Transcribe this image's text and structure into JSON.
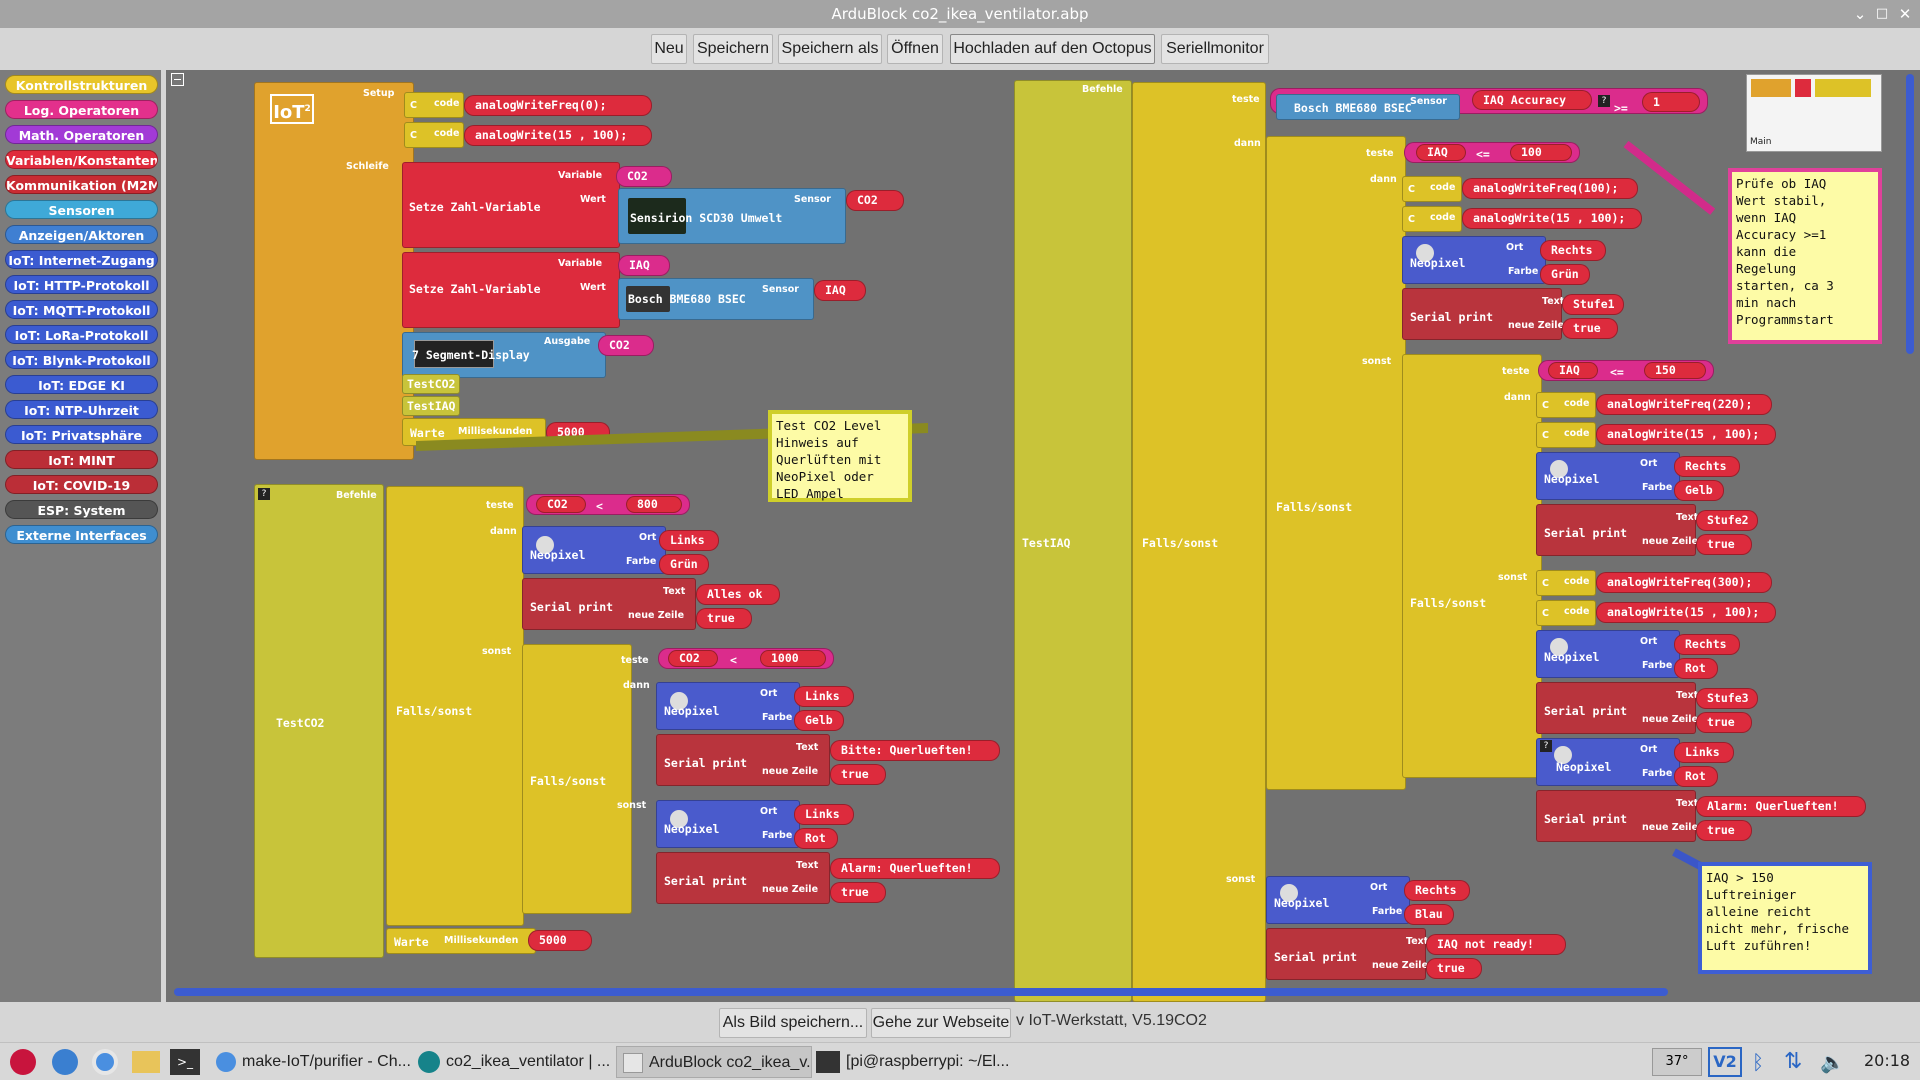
{
  "window": {
    "title": "ArduBlock co2_ikea_ventilator.abp",
    "min": "⌄",
    "max": "□",
    "close": "✕"
  },
  "toolbar": [
    "Neu",
    "Speichern",
    "Speichern als",
    "Öffnen",
    "Hochladen auf den Octopus",
    "Seriellmonitor"
  ],
  "palette": [
    {
      "label": "Kontrollstrukturen",
      "color": "#e8c52a"
    },
    {
      "label": "Log. Operatoren",
      "color": "#e3308c"
    },
    {
      "label": "Math. Operatoren",
      "color": "#a23ad6"
    },
    {
      "label": "Variablen/Konstanten",
      "color": "#e02b3c"
    },
    {
      "label": "Kommunikation (M2M)",
      "color": "#c92b33"
    },
    {
      "label": "Sensoren",
      "color": "#3fa9d8"
    },
    {
      "label": "Anzeigen/Aktoren",
      "color": "#3f7fd2"
    },
    {
      "label": "IoT: Internet-Zugang",
      "color": "#3b5bd1"
    },
    {
      "label": "IoT: HTTP-Protokoll",
      "color": "#3b5bd1"
    },
    {
      "label": "IoT: MQTT-Protokoll",
      "color": "#3b5bd1"
    },
    {
      "label": "IoT: LoRa-Protokoll",
      "color": "#3b5bd1"
    },
    {
      "label": "IoT: Blynk-Protokoll",
      "color": "#3b5bd1"
    },
    {
      "label": "IoT: EDGE KI",
      "color": "#3b5bd1"
    },
    {
      "label": "IoT: NTP-Uhrzeit",
      "color": "#3b5bd1"
    },
    {
      "label": "IoT: Privatsphäre",
      "color": "#3b5bd1"
    },
    {
      "label": "IoT: MINT",
      "color": "#bb2e37"
    },
    {
      "label": "IoT: COVID-19",
      "color": "#bb2e37"
    },
    {
      "label": "ESP: System",
      "color": "#555555"
    },
    {
      "label": "Externe Interfaces",
      "color": "#3f8ed0"
    }
  ],
  "blocks": {
    "iot": "IoT",
    "iot_sup": "2",
    "setup": "Setup",
    "schleife": "Schleife",
    "c": "C",
    "code": "code",
    "awf0": "analogWriteFreq(0);",
    "aw100": "analogWrite(15 , 100);",
    "setze": "Setze Zahl-Variable",
    "variable": "Variable",
    "wert": "Wert",
    "sensor": "Sensor",
    "co2": "CO2",
    "iaq": "IAQ",
    "scd30": "Sensirion SCD30 Umwelt",
    "bme680": "Bosch BME680 BSEC",
    "seg": "7 Segment-Display",
    "ausgabe": "Ausgabe",
    "testco2": "TestCO2",
    "testiaq": "TestIAQ",
    "warte": "Warte",
    "millis": "Millisekunden",
    "v5000": "5000",
    "befehle": "Befehle",
    "teste": "teste",
    "dann": "dann",
    "sonst": "sonst",
    "falls": "Falls/sonst",
    "lt": "<",
    "le": "<=",
    "ge": ">=",
    "v800": "800",
    "v1000": "1000",
    "v100": "100",
    "v150": "150",
    "v1": "1",
    "neopixel": "Neopixel",
    "ort": "Ort",
    "farbe": "Farbe",
    "links": "Links",
    "rechts": "Rechts",
    "gruen": "Grün",
    "gelb": "Gelb",
    "rot": "Rot",
    "blau": "Blau",
    "serial": "Serial print",
    "text": "Text",
    "neue": "neue Zeile",
    "true": "true",
    "allesok": "Alles ok",
    "bitte": "Bitte: Querlueften!",
    "alarm": "Alarm: Querlueften!",
    "iaqacc": "IAQ Accuracy",
    "awf100": "analogWriteFreq(100);",
    "awf220": "analogWriteFreq(220);",
    "awf300": "analogWriteFreq(300);",
    "stufe1": "Stufe1",
    "stufe2": "Stufe2",
    "stufe3": "Stufe3",
    "notready": "IAQ not ready!",
    "q": "?"
  },
  "notes": {
    "co2": "Test CO2 Level\nHinweis auf\nQuerlüften mit\nNeoPixel oder\nLED Ampel",
    "iaq_acc": "Prüfe ob IAQ\nWert stabil,\nwenn IAQ\nAccuracy >=1\nkann die\nRegelung\nstarten, ca 3\nmin nach\nProgrammstart",
    "iaq150": "IAQ > 150\nLuftreiniger\nalleine reicht\nnicht mehr, frische\nLuft zuführen!"
  },
  "minimap": {
    "label": "Main"
  },
  "bottom": {
    "save_img": "Als Bild speichern...",
    "web": "Gehe zur Webseite",
    "version": "v IoT-Werkstatt, V5.19CO2"
  },
  "taskbar": {
    "t1": "make-IoT/purifier - Ch...",
    "t2": "co2_ikea_ventilator | ...",
    "t3": "ArduBlock co2_ikea_v...",
    "t4": "[pi@raspberrypi: ~/El...",
    "temp": "37°",
    "vnc": "V2",
    "clock": "20:18"
  }
}
